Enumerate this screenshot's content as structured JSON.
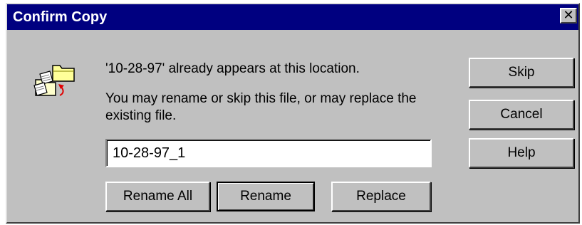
{
  "window": {
    "title": "Confirm Copy",
    "close_glyph": "✕"
  },
  "icon": {
    "name": "file-copy-conflict-icon"
  },
  "message": {
    "line1": "'10-28-97' already appears at this location.",
    "line2": "You may rename or skip this file, or may replace the existing file."
  },
  "input": {
    "value": "10-28-97_1"
  },
  "buttons": {
    "skip": "Skip",
    "cancel": "Cancel",
    "help": "Help",
    "rename_all": "Rename All",
    "rename": "Rename",
    "replace": "Replace"
  },
  "colors": {
    "titlebar": "#000080",
    "face": "#c0c0c0"
  }
}
